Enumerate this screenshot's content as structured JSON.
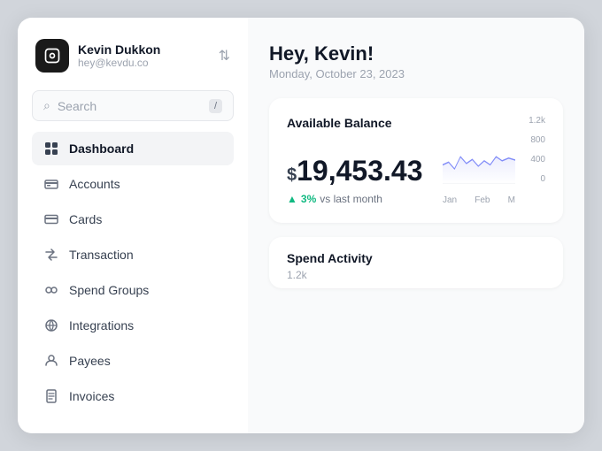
{
  "sidebar": {
    "user": {
      "name": "Kevin Dukkon",
      "email": "hey@kevdu.co"
    },
    "search": {
      "placeholder": "Search",
      "shortcut": "/"
    },
    "nav_items": [
      {
        "id": "dashboard",
        "label": "Dashboard",
        "icon": "dashboard",
        "active": true
      },
      {
        "id": "accounts",
        "label": "Accounts",
        "icon": "accounts",
        "active": false
      },
      {
        "id": "cards",
        "label": "Cards",
        "icon": "cards",
        "active": false
      },
      {
        "id": "transaction",
        "label": "Transaction",
        "icon": "transaction",
        "active": false
      },
      {
        "id": "spend-groups",
        "label": "Spend Groups",
        "icon": "spend-groups",
        "active": false
      },
      {
        "id": "integrations",
        "label": "Integrations",
        "icon": "integrations",
        "active": false
      },
      {
        "id": "payees",
        "label": "Payees",
        "icon": "payees",
        "active": false
      },
      {
        "id": "invoices",
        "label": "Invoices",
        "icon": "invoices",
        "active": false
      }
    ]
  },
  "main": {
    "greeting": "Hey, Kevin!",
    "date": "Monday, October 23, 2023",
    "balance_card": {
      "title": "Available Balance",
      "amount": "$19,453.43",
      "currency_symbol": "$",
      "amount_value": "19,453.43",
      "change_percent": "3%",
      "change_label": "vs last month",
      "chart": {
        "y_labels": [
          "1.2k",
          "800",
          "400",
          "0"
        ],
        "x_labels": [
          "Jan",
          "Feb",
          "M"
        ],
        "points": [
          [
            0,
            300
          ],
          [
            20,
            280
          ],
          [
            40,
            310
          ],
          [
            60,
            260
          ],
          [
            80,
            290
          ],
          [
            100,
            270
          ],
          [
            120,
            300
          ],
          [
            140,
            280
          ],
          [
            160,
            290
          ],
          [
            180,
            270
          ],
          [
            200,
            285
          ],
          [
            220,
            275
          ]
        ]
      }
    },
    "spend_activity": {
      "title": "Spend Activity",
      "value": "1.2k"
    }
  }
}
